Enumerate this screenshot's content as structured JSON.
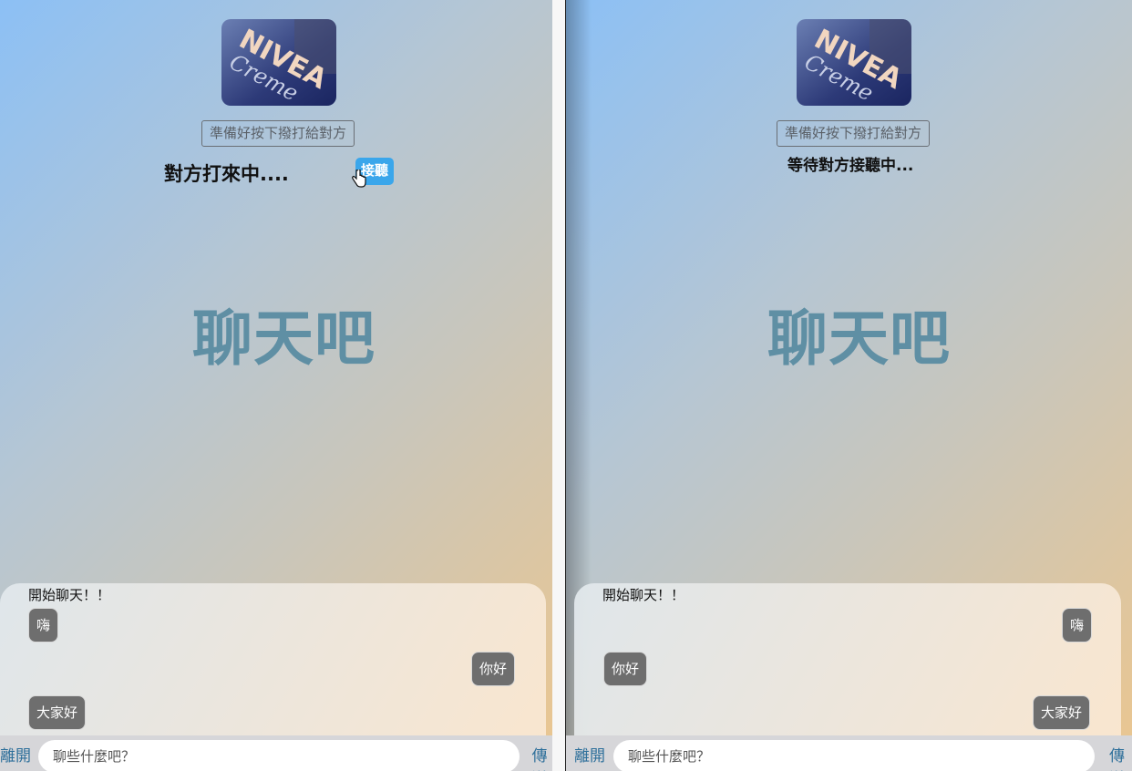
{
  "left_window": {
    "logo_text": "NIVEA Creme",
    "status_button": "準備好按下撥打給對方",
    "incoming_text": "對方打來中....",
    "answer_button": "接聽",
    "title": "聊天吧",
    "chat": {
      "start": "開始聊天！！",
      "messages": [
        {
          "text": "嗨",
          "side": "left"
        },
        {
          "text": "你好",
          "side": "right"
        },
        {
          "text": "大家好",
          "side": "left"
        }
      ]
    },
    "bottom": {
      "leave_button": "離開",
      "input_placeholder": "聊些什麼吧？",
      "send_button": "傳送"
    }
  },
  "right_window": {
    "logo_text": "NIVEA Creme",
    "status_button": "準備好按下撥打給對方",
    "waiting_text": "等待對方接聽中...",
    "title": "聊天吧",
    "chat": {
      "start": "開始聊天！！",
      "messages": [
        {
          "text": "嗨",
          "side": "right"
        },
        {
          "text": "你好",
          "side": "left"
        },
        {
          "text": "大家好",
          "side": "right"
        }
      ]
    },
    "bottom": {
      "leave_button": "離開",
      "input_placeholder": "聊些什麼吧？",
      "send_button": "傳送"
    }
  },
  "colors": {
    "answer_button": "#3aa6eb",
    "title": "#5f8fa4",
    "bubble": "#6e6e6e",
    "link": "#2d6f9a"
  },
  "icons": [
    "nivea-logo-icon",
    "hand-pointer-cursor-icon"
  ]
}
